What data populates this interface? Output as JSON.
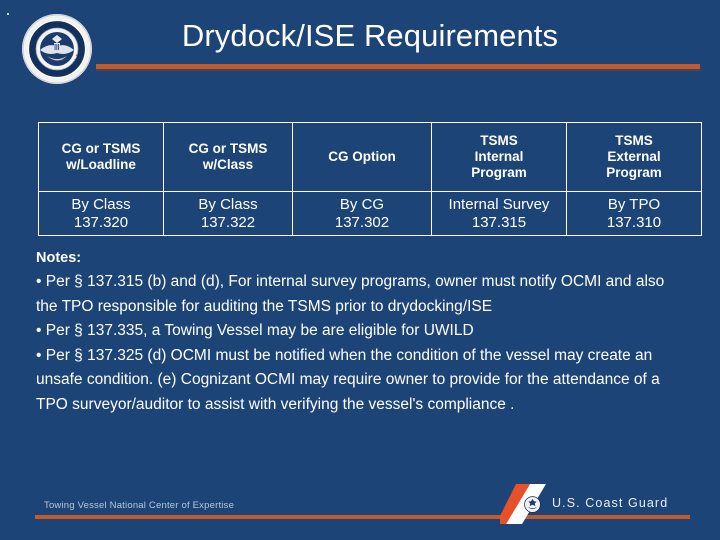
{
  "slide": {
    "title": "Drydock/ISE Requirements",
    "background_color": "#1d4477",
    "accent_color": "#c15a2c",
    "text_color": "#ffffff"
  },
  "seal": {
    "name": "dhs-seal",
    "alt": "U.S. Department of Homeland Security seal",
    "ring_text_top": "U.S. DEPARTMENT OF",
    "ring_text_bottom": "HOMELAND SECURITY"
  },
  "table": {
    "headers": [
      "CG or TSMS w/Loadline",
      "CG or TSMS w/Class",
      "CG Option",
      "TSMS Internal Program",
      "TSMS External Program"
    ],
    "headers_lines": [
      [
        "CG or TSMS",
        "w/Loadline"
      ],
      [
        "CG or TSMS",
        "w/Class"
      ],
      [
        "CG Option"
      ],
      [
        "TSMS",
        "Internal",
        "Program"
      ],
      [
        "TSMS",
        "External",
        "Program"
      ]
    ],
    "rows": [
      {
        "cells": [
          {
            "method": "By Class",
            "citation": "137.320"
          },
          {
            "method": "By Class",
            "citation": "137.322"
          },
          {
            "method": "By CG",
            "citation": "137.302"
          },
          {
            "method": "Internal Survey",
            "citation": "137.315"
          },
          {
            "method": "By TPO",
            "citation": "137.310"
          }
        ]
      }
    ]
  },
  "notes": {
    "heading": "Notes:",
    "items": [
      "• Per § 137.315  (b) and (d), For internal survey programs, owner must notify OCMI and also the TPO responsible for auditing the TSMS prior to drydocking/ISE",
      "• Per § 137.335, a Towing Vessel may be are eligible for UWILD",
      "• Per § 137.325 (d) OCMI must be notified when the condition of the vessel may create an unsafe condition.  (e)  Cognizant OCMI may require owner to provide for the attendance of a TPO surveyor/auditor  to assist with verifying the vessel's compliance ."
    ]
  },
  "footer": {
    "left_text": "Towing Vessel National Center of Expertise",
    "brand_text": "U.S. Coast Guard",
    "stripe_colors": {
      "orange": "#e8502a",
      "white": "#ffffff",
      "navy": "#0e2f5e"
    }
  }
}
